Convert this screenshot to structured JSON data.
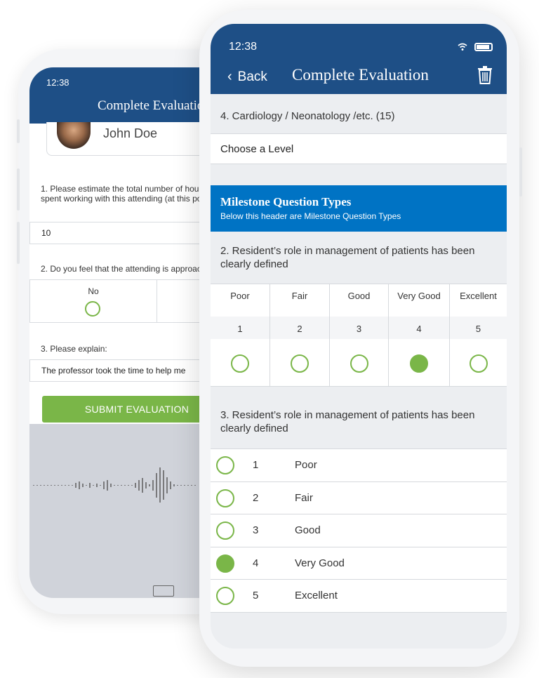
{
  "back_screen": {
    "time": "12:38",
    "title": "Complete Evaluation",
    "profile_name": "John Doe",
    "question1": "1. Please estimate the total number of hours you have spent working with this attending (at this point):",
    "answer1": "10",
    "question2": "2. Do you feel that the attending is approachable?",
    "choice_no": "No",
    "question3": "3. Please explain:",
    "answer3": "The professor took the time to help me",
    "submit_label": "SUBMIT EVALUATION"
  },
  "front_screen": {
    "time": "12:38",
    "back_label": "Back",
    "title": "Complete Evaluation",
    "question4": "4. Cardiology / Neonatology /etc. (15)",
    "select_placeholder": "Choose a Level",
    "banner_title": "Milestone Question Types",
    "banner_subtitle": "Below this header are Milestone Question Types",
    "question2": "2. Resident’s role in management of patients has been clearly defined",
    "grid": [
      {
        "label": "Poor",
        "num": "1",
        "selected": false
      },
      {
        "label": "Fair",
        "num": "2",
        "selected": false
      },
      {
        "label": "Good",
        "num": "3",
        "selected": false
      },
      {
        "label": "Very Good",
        "num": "4",
        "selected": true
      },
      {
        "label": "Excellent",
        "num": "5",
        "selected": false
      }
    ],
    "question3": "3. Resident’s role in management of patients has been clearly defined",
    "list": [
      {
        "num": "1",
        "label": "Poor",
        "selected": false
      },
      {
        "num": "2",
        "label": "Fair",
        "selected": false
      },
      {
        "num": "3",
        "label": "Good",
        "selected": false
      },
      {
        "num": "4",
        "label": "Very Good",
        "selected": true
      },
      {
        "num": "5",
        "label": "Excellent",
        "selected": false
      }
    ]
  },
  "colors": {
    "header": "#1e4f86",
    "banner": "#0073c4",
    "accent_green": "#7ab648"
  },
  "icons": {
    "back": "chevron-left-icon",
    "delete": "trash-icon",
    "wifi": "wifi-icon",
    "battery": "battery-icon",
    "keyboard": "keyboard-icon"
  }
}
